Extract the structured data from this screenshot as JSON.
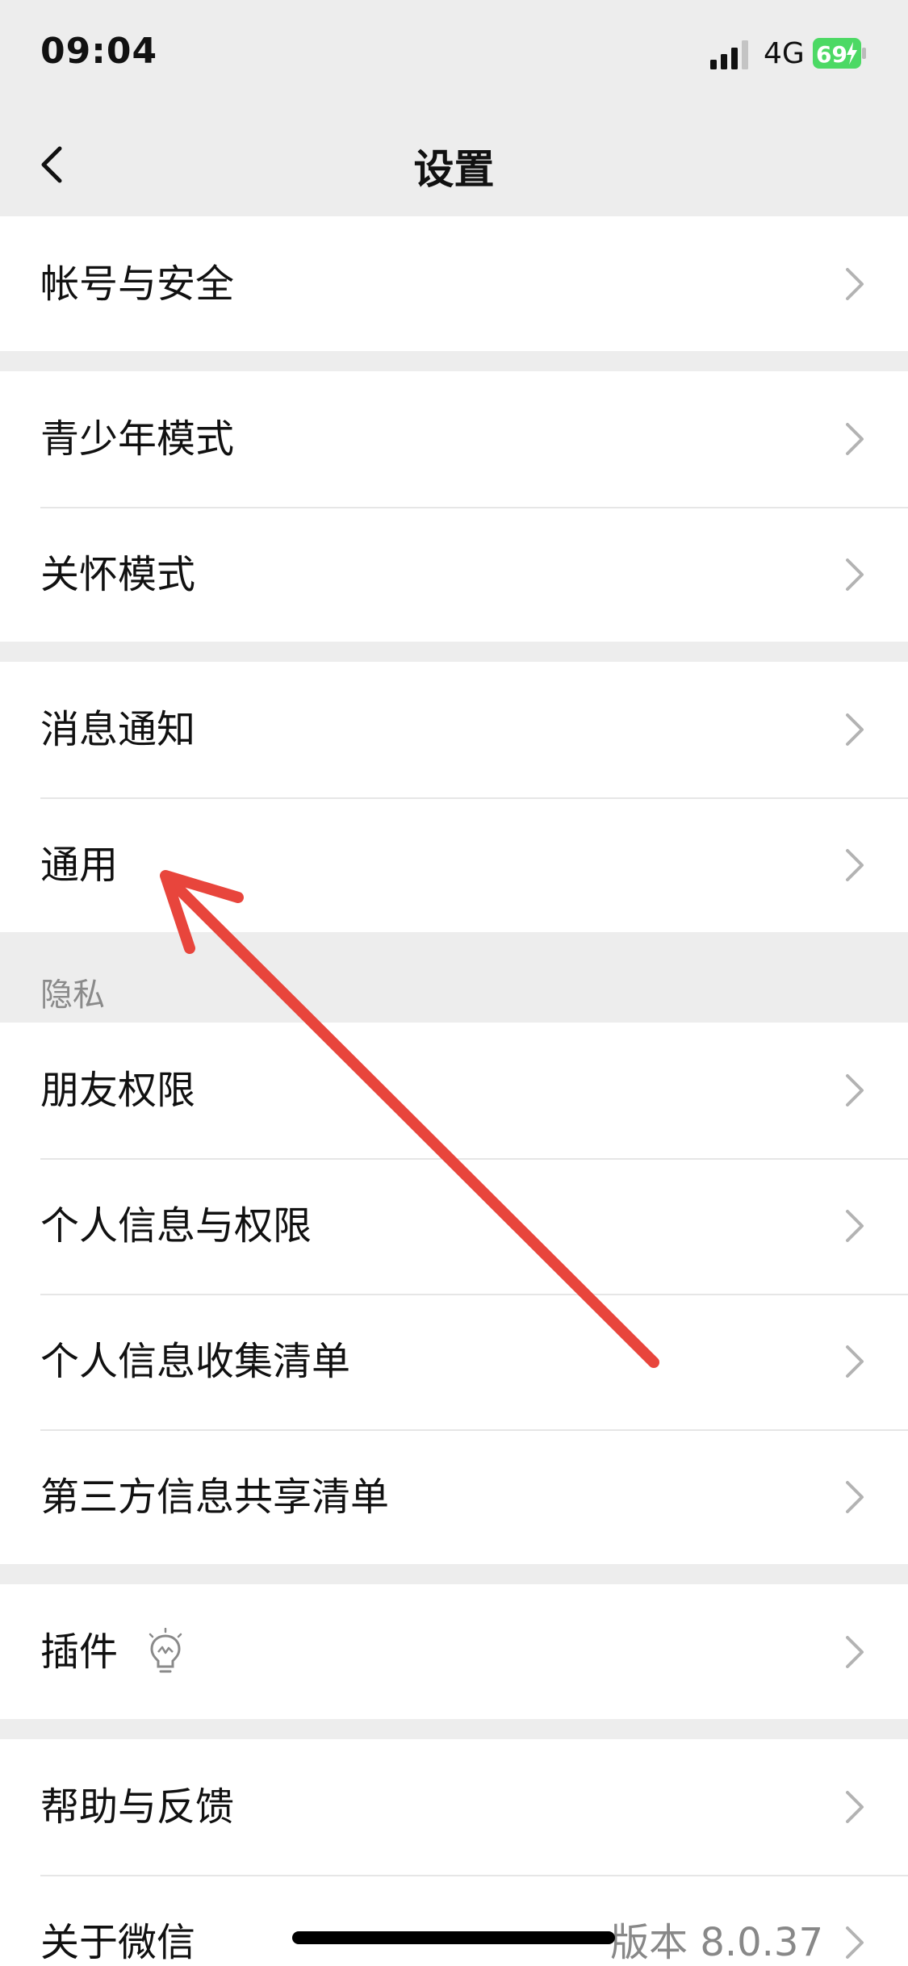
{
  "status_bar": {
    "time": "09:04",
    "network": "4G",
    "battery": "69"
  },
  "nav": {
    "title": "设置",
    "back_icon": "chevron-left-icon"
  },
  "groups": [
    {
      "items": [
        {
          "label": "帐号与安全"
        }
      ]
    },
    {
      "items": [
        {
          "label": "青少年模式"
        },
        {
          "label": "关怀模式"
        }
      ]
    },
    {
      "items": [
        {
          "label": "消息通知"
        },
        {
          "label": "通用"
        }
      ]
    },
    {
      "header": "隐私",
      "items": [
        {
          "label": "朋友权限"
        },
        {
          "label": "个人信息与权限"
        },
        {
          "label": "个人信息收集清单"
        },
        {
          "label": "第三方信息共享清单"
        }
      ]
    },
    {
      "items": [
        {
          "label": "插件",
          "icon": "lightbulb-icon"
        }
      ]
    },
    {
      "items": [
        {
          "label": "帮助与反馈"
        },
        {
          "label": "关于微信",
          "value": "版本 8.0.37"
        }
      ]
    }
  ],
  "annotation": {
    "icon": "red-arrow-icon",
    "color": "#e8453c"
  },
  "colors": {
    "background": "#ededed",
    "battery": "#4cd964",
    "text": "#111111",
    "secondary": "#888888"
  }
}
